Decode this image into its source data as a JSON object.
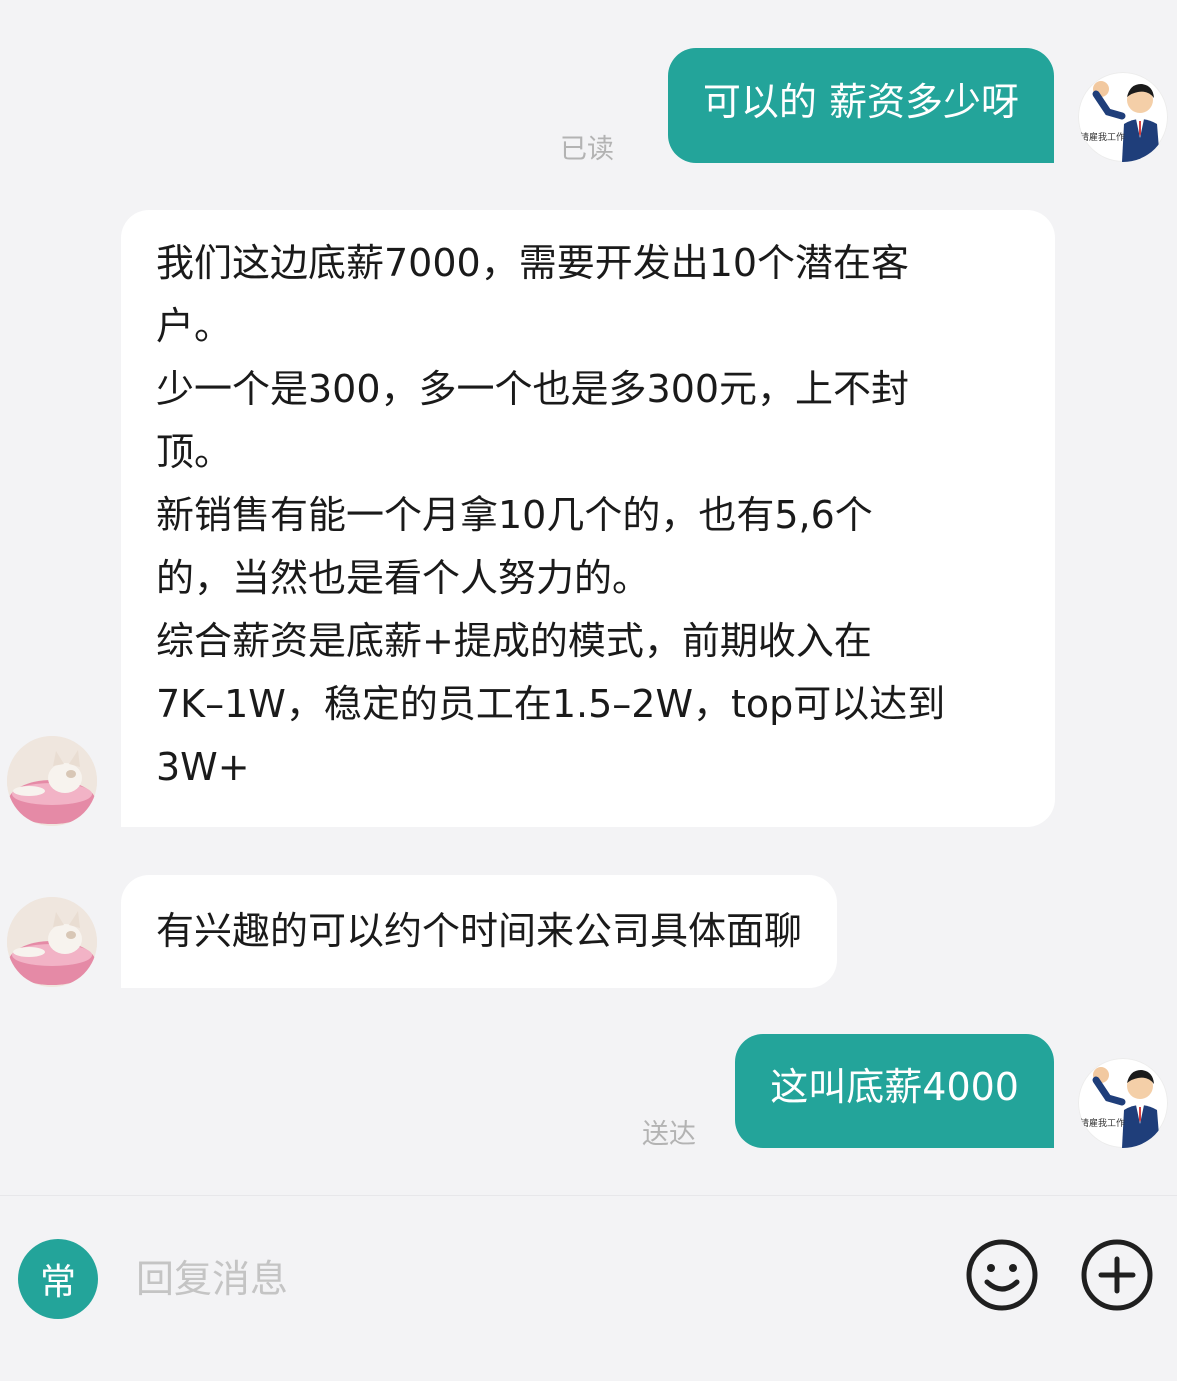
{
  "messages": [
    {
      "side": "out",
      "text": "可以的 薪资多少呀",
      "status": "已读"
    },
    {
      "side": "in",
      "lines": [
        "我们这边底薪7000，需要开发出10个潜在客",
        "户。",
        "少一个是300，多一个也是多300元，上不封",
        "顶。",
        "新销售有能一个月拿10几个的，也有5,6个",
        "的，当然也是看个人努力的。",
        "综合薪资是底薪+提成的模式，前期收入在",
        "7K–1W，稳定的员工在1.5–2W，top可以达到",
        "3W+"
      ]
    },
    {
      "side": "in",
      "text": "有兴趣的可以约个时间来公司具体面聊"
    },
    {
      "side": "out",
      "text": "这叫底薪4000",
      "status": "送达"
    }
  ],
  "my_avatar_caption": "请雇我工作",
  "input_bar": {
    "quick_reply_label": "常",
    "placeholder": "回复消息",
    "emoji_icon": "smile-icon",
    "more_icon": "plus-icon"
  },
  "colors": {
    "accent": "#23a49a",
    "background": "#f3f3f5",
    "incoming_bubble": "#ffffff",
    "status_text": "#b3b3b3"
  }
}
